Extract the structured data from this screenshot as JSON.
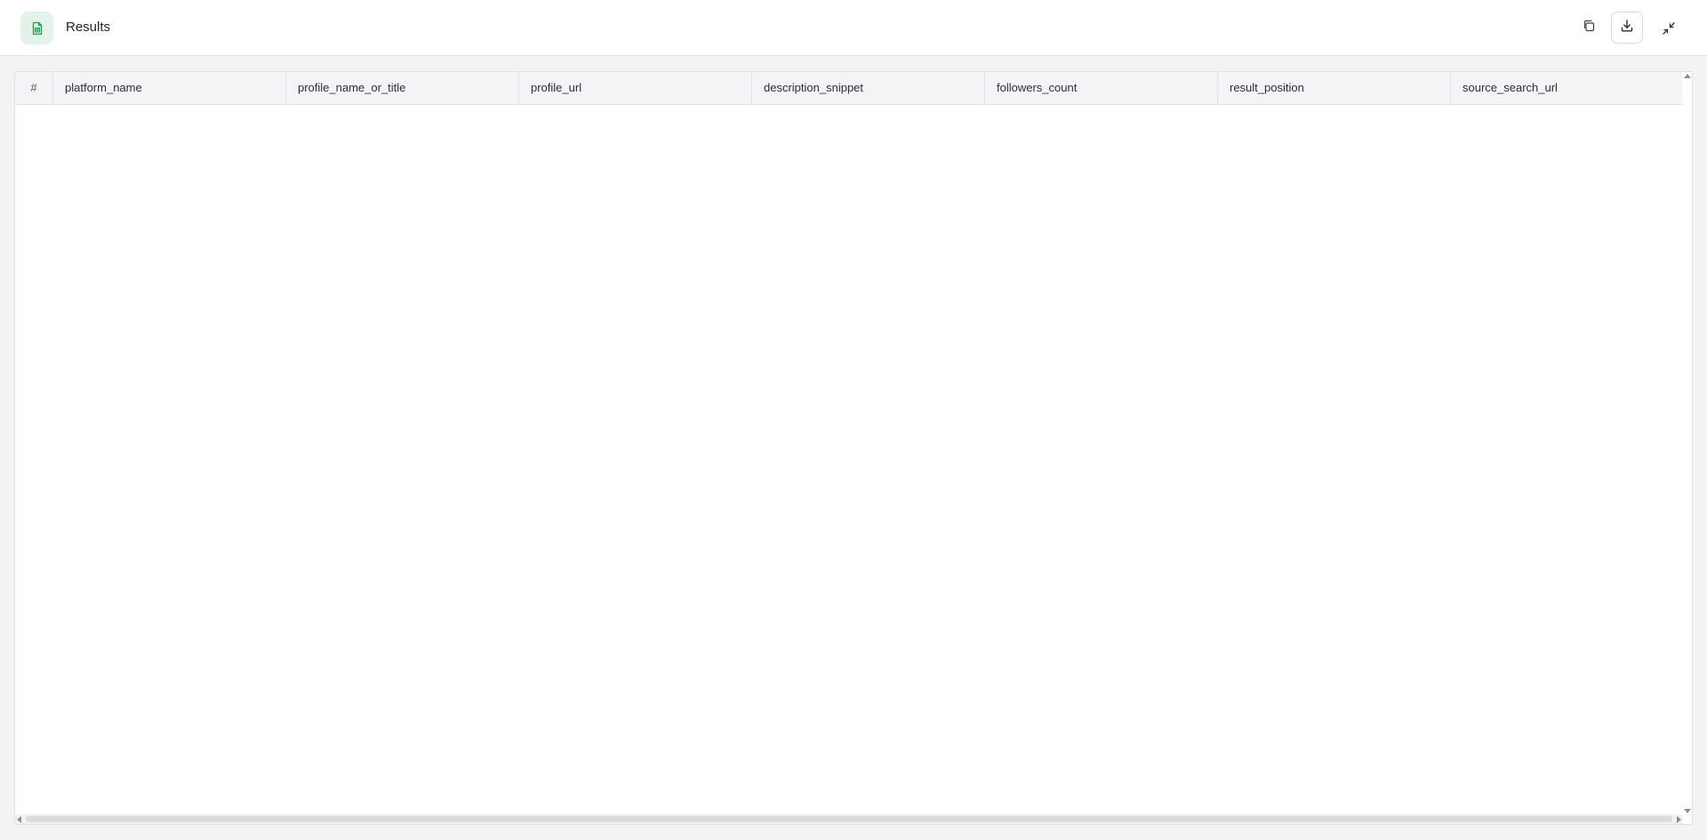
{
  "header": {
    "title": "Results",
    "icon": "spreadsheet-icon",
    "accent_color": "#1f9d55",
    "badge_color": "#e3f3ea",
    "actions": [
      {
        "name": "copy",
        "icon": "copy-icon"
      },
      {
        "name": "download",
        "icon": "download-icon"
      },
      {
        "name": "collapse",
        "icon": "collapse-icon"
      }
    ]
  },
  "table": {
    "columns": [
      "#",
      "platform_name",
      "profile_name_or_title",
      "profile_url",
      "description_snippet",
      "followers_count",
      "result_position",
      "source_search_url"
    ],
    "rows": []
  }
}
